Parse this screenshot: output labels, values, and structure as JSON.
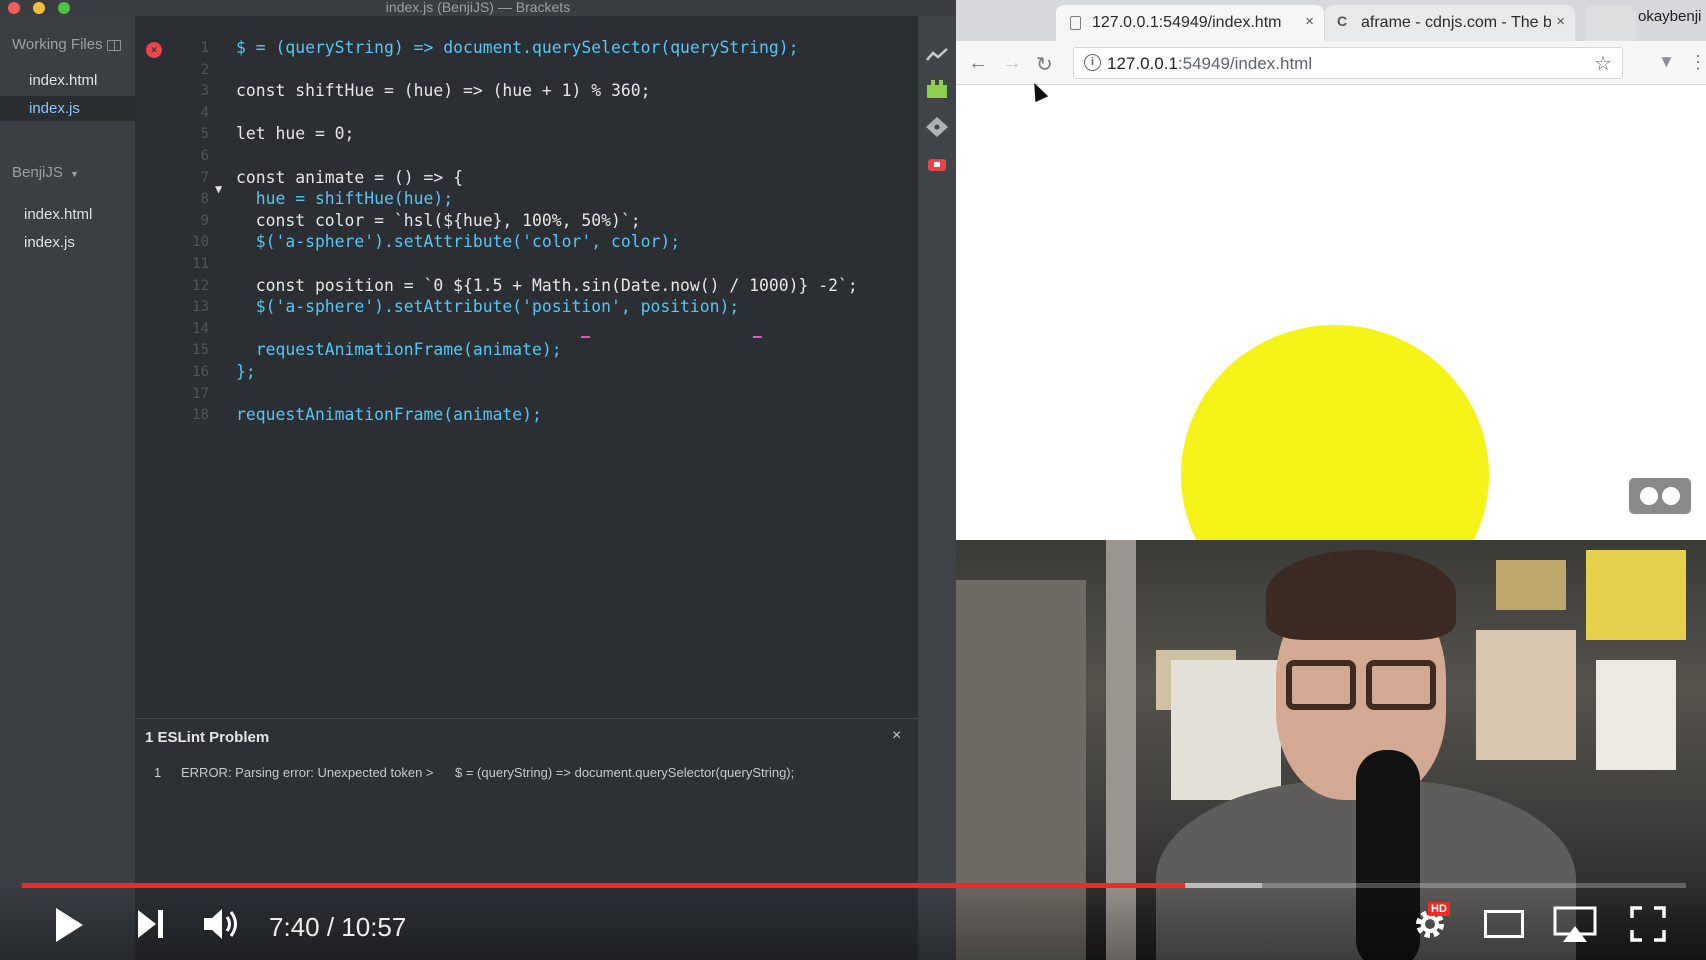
{
  "brackets": {
    "window_title": "index.js (BenjiJS) — Brackets",
    "sidebar": {
      "working_files_label": "Working Files",
      "working_files": [
        "index.html",
        "index.js"
      ],
      "project_label": "BenjiJS",
      "project_files": [
        "index.html",
        "index.js"
      ]
    },
    "editor": {
      "line_numbers": [
        "1",
        "2",
        "3",
        "4",
        "5",
        "6",
        "7",
        "8",
        "9",
        "10",
        "11",
        "12",
        "13",
        "14",
        "15",
        "16",
        "17",
        "18"
      ],
      "lines": [
        "$ = (queryString) => document.querySelector(queryString);",
        "",
        "const shiftHue = (hue) => (hue + 1) % 360;",
        "",
        "let hue = 0;",
        "",
        "const animate = () => {",
        "  hue = shiftHue(hue);",
        "  const color = `hsl(${hue}, 100%, 50%)`;",
        "  $('a-sphere').setAttribute('color', color);",
        "",
        "  const position = `0 ${1.5 + Math.sin(Date.now() / 1000)} -2`;",
        "  $('a-sphere').setAttribute('position', position);",
        "",
        "  requestAnimationFrame(animate);",
        "};",
        "",
        "requestAnimationFrame(animate);"
      ]
    },
    "lint_panel": {
      "title": "1 ESLint Problem",
      "close": "×",
      "row_number": "1",
      "message": "ERROR: Parsing error: Unexpected token >",
      "code": "$ = (queryString) => document.querySelector(queryString);"
    }
  },
  "chrome": {
    "tabs": [
      {
        "title": "127.0.0.1:54949/index.html",
        "close": "×"
      },
      {
        "favicon": "C",
        "title": "aframe - cdnjs.com - The b",
        "close": "×"
      }
    ],
    "profile_name": "okaybenji",
    "url_host": "127.0.0.1",
    "url_rest": ":54949/index.html",
    "info_glyph": "i",
    "sphere_color": "#f5f217"
  },
  "video": {
    "time_display": "7:40 / 10:57",
    "progress_played_fraction": 0.6989,
    "progress_buffered_fraction": 0.745,
    "hd_badge": "HD",
    "accent": "#f12b24"
  },
  "icons": {
    "play": "play-icon",
    "next": "next-icon",
    "volume": "volume-icon",
    "settings": "gear-icon",
    "theater": "theater-icon",
    "airplay": "airplay-icon",
    "fullscreen": "fullscreen-icon"
  }
}
